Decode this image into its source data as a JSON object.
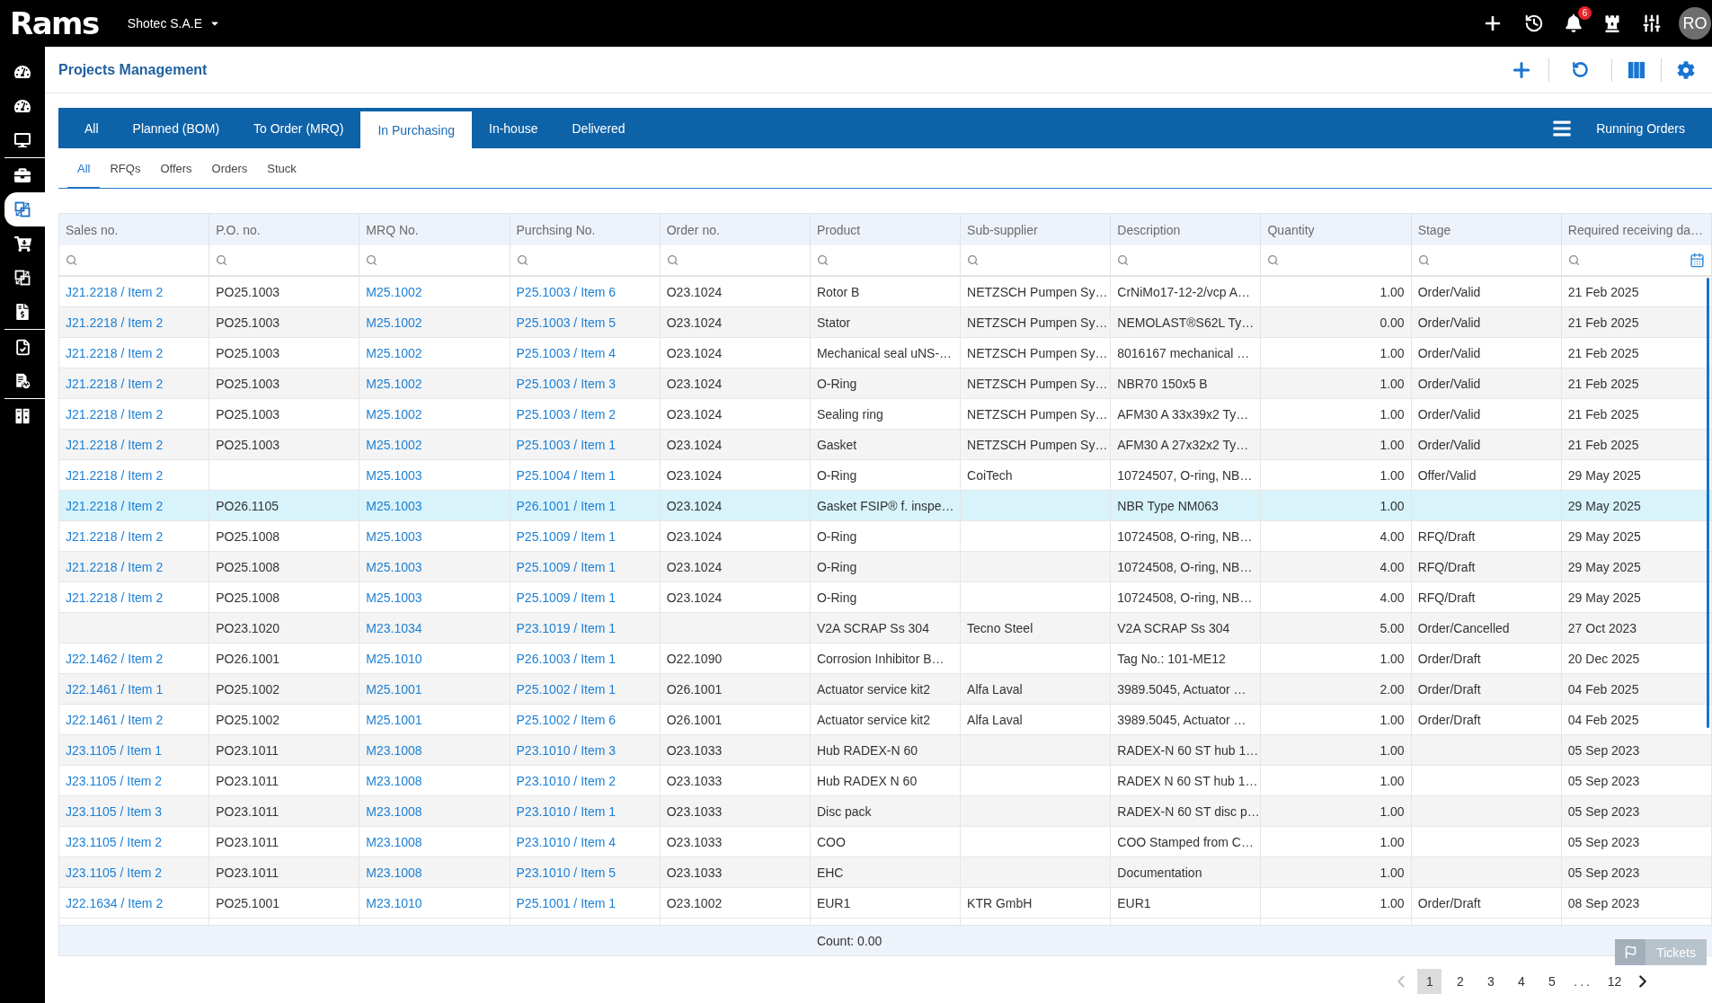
{
  "top_bar": {
    "logo": "Rams",
    "company": "Shotec S.A.E",
    "notifications": "6",
    "avatar": "RO"
  },
  "sidebar": {
    "groups": [
      {
        "items": [
          {
            "selected": false
          },
          {
            "selected": false
          },
          {
            "selected": false
          }
        ]
      },
      {
        "items": [
          {
            "selected": false
          },
          {
            "selected": true
          },
          {
            "selected": false
          },
          {
            "selected": false
          },
          {
            "selected": false
          }
        ]
      },
      {
        "items": [
          {
            "selected": false
          },
          {
            "selected": false
          }
        ]
      },
      {
        "items": [
          {
            "selected": false
          }
        ]
      }
    ]
  },
  "page": {
    "title": "Projects Management"
  },
  "tabs": [
    {
      "label": "All",
      "selected": false
    },
    {
      "label": "Planned (BOM)",
      "selected": false
    },
    {
      "label": "To Order (MRQ)",
      "selected": false
    },
    {
      "label": "In Purchasing",
      "selected": true
    },
    {
      "label": "In-house",
      "selected": false
    },
    {
      "label": "Delivered",
      "selected": false
    }
  ],
  "running_orders": "Running Orders",
  "subtabs": [
    {
      "label": "All",
      "selected": true
    },
    {
      "label": "RFQs",
      "selected": false
    },
    {
      "label": "Offers",
      "selected": false
    },
    {
      "label": "Orders",
      "selected": false
    },
    {
      "label": "Stuck",
      "selected": false
    }
  ],
  "table": {
    "columns": [
      {
        "label": "Sales no.",
        "kind": "link"
      },
      {
        "label": "P.O. no.",
        "kind": "text"
      },
      {
        "label": "MRQ No.",
        "kind": "link"
      },
      {
        "label": "Purchsing No.",
        "kind": "link"
      },
      {
        "label": "Order no.",
        "kind": "text"
      },
      {
        "label": "Product",
        "kind": "text"
      },
      {
        "label": "Sub-supplier",
        "kind": "text"
      },
      {
        "label": "Description",
        "kind": "text"
      },
      {
        "label": "Quantity",
        "kind": "number"
      },
      {
        "label": "Stage",
        "kind": "text"
      },
      {
        "label": "Required receiving da…",
        "kind": "date"
      }
    ],
    "rows": [
      {
        "selected": false,
        "cells": [
          "J21.2218 / Item 2",
          "PO25.1003",
          "M25.1002",
          "P25.1003 / Item 6",
          "O23.1024",
          "Rotor B",
          "NETZSCH Pumpen Sy…",
          "CrNiMo17-12-2/vcp A…",
          "1.00",
          "Order/Valid",
          "21 Feb 2025"
        ]
      },
      {
        "selected": false,
        "cells": [
          "J21.2218 / Item 2",
          "PO25.1003",
          "M25.1002",
          "P25.1003 / Item 5",
          "O23.1024",
          "Stator",
          "NETZSCH Pumpen Sy…",
          "NEMOLAST®S62L Ty…",
          "0.00",
          "Order/Valid",
          "21 Feb 2025"
        ]
      },
      {
        "selected": false,
        "cells": [
          "J21.2218 / Item 2",
          "PO25.1003",
          "M25.1002",
          "P25.1003 / Item 4",
          "O23.1024",
          "Mechanical seal uNS-…",
          "NETZSCH Pumpen Sy…",
          "8016167 mechanical …",
          "1.00",
          "Order/Valid",
          "21 Feb 2025"
        ]
      },
      {
        "selected": false,
        "cells": [
          "J21.2218 / Item 2",
          "PO25.1003",
          "M25.1002",
          "P25.1003 / Item 3",
          "O23.1024",
          "O-Ring",
          "NETZSCH Pumpen Sy…",
          "NBR70 150x5 B",
          "1.00",
          "Order/Valid",
          "21 Feb 2025"
        ]
      },
      {
        "selected": false,
        "cells": [
          "J21.2218 / Item 2",
          "PO25.1003",
          "M25.1002",
          "P25.1003 / Item 2",
          "O23.1024",
          "Sealing ring",
          "NETZSCH Pumpen Sy…",
          "AFM30 A 33x39x2 Ty…",
          "1.00",
          "Order/Valid",
          "21 Feb 2025"
        ]
      },
      {
        "selected": false,
        "cells": [
          "J21.2218 / Item 2",
          "PO25.1003",
          "M25.1002",
          "P25.1003 / Item 1",
          "O23.1024",
          "Gasket",
          "NETZSCH Pumpen Sy…",
          "AFM30 A 27x32x2 Ty…",
          "1.00",
          "Order/Valid",
          "21 Feb 2025"
        ]
      },
      {
        "selected": false,
        "cells": [
          "J21.2218 / Item 2",
          null,
          "M25.1003",
          "P25.1004 / Item 1",
          "O23.1024",
          "O-Ring",
          "CoiTech",
          "10724507, O-ring, NB…",
          "1.00",
          "Offer/Valid",
          "29 May 2025"
        ]
      },
      {
        "selected": true,
        "cells": [
          "J21.2218 / Item 2",
          "PO26.1105",
          "M25.1003",
          "P26.1001 / Item 1",
          "O23.1024",
          "Gasket FSIP® f. inspe…",
          null,
          "NBR Type NM063",
          "1.00",
          null,
          "29 May 2025"
        ]
      },
      {
        "selected": false,
        "cells": [
          "J21.2218 / Item 2",
          "PO25.1008",
          "M25.1003",
          "P25.1009 / Item 1",
          "O23.1024",
          "O-Ring",
          null,
          "10724508, O-ring, NB…",
          "4.00",
          "RFQ/Draft",
          "29 May 2025"
        ]
      },
      {
        "selected": false,
        "cells": [
          "J21.2218 / Item 2",
          "PO25.1008",
          "M25.1003",
          "P25.1009 / Item 1",
          "O23.1024",
          "O-Ring",
          null,
          "10724508, O-ring, NB…",
          "4.00",
          "RFQ/Draft",
          "29 May 2025"
        ]
      },
      {
        "selected": false,
        "cells": [
          "J21.2218 / Item 2",
          "PO25.1008",
          "M25.1003",
          "P25.1009 / Item 1",
          "O23.1024",
          "O-Ring",
          null,
          "10724508, O-ring, NB…",
          "4.00",
          "RFQ/Draft",
          "29 May 2025"
        ]
      },
      {
        "selected": false,
        "cells": [
          null,
          "PO23.1020",
          "M23.1034",
          "P23.1019 / Item 1",
          null,
          "V2A SCRAP Ss 304",
          "Tecno Steel",
          "V2A SCRAP Ss 304",
          "5.00",
          "Order/Cancelled",
          "27 Oct 2023"
        ]
      },
      {
        "selected": false,
        "cells": [
          "J22.1462 / Item 2",
          "PO26.1001",
          "M25.1010",
          "P26.1003 / Item 1",
          "O22.1090",
          "Corrosion Inhibitor B…",
          null,
          "Tag No.: 101-ME12",
          "1.00",
          "Order/Draft",
          "20 Dec 2025"
        ]
      },
      {
        "selected": false,
        "cells": [
          "J22.1461 / Item 1",
          "PO25.1002",
          "M25.1001",
          "P25.1002 / Item 1",
          "O26.1001",
          "Actuator service kit2",
          "Alfa Laval",
          "3989.5045, Actuator …",
          "2.00",
          "Order/Draft",
          "04 Feb 2025"
        ]
      },
      {
        "selected": false,
        "cells": [
          "J22.1461 / Item 2",
          "PO25.1002",
          "M25.1001",
          "P25.1002 / Item 6",
          "O26.1001",
          "Actuator service kit2",
          "Alfa Laval",
          "3989.5045, Actuator …",
          "1.00",
          "Order/Draft",
          "04 Feb 2025"
        ]
      },
      {
        "selected": false,
        "cells": [
          "J23.1105 / Item 1",
          "PO23.1011",
          "M23.1008",
          "P23.1010 / Item 3",
          "O23.1033",
          "Hub RADEX-N 60",
          null,
          "RADEX-N 60 ST hub 1…",
          "1.00",
          null,
          "05 Sep 2023"
        ]
      },
      {
        "selected": false,
        "cells": [
          "J23.1105 / Item 2",
          "PO23.1011",
          "M23.1008",
          "P23.1010 / Item 2",
          "O23.1033",
          "Hub RADEX N 60",
          null,
          "RADEX N 60 ST hub 1…",
          "1.00",
          null,
          "05 Sep 2023"
        ]
      },
      {
        "selected": false,
        "cells": [
          "J23.1105 / Item 3",
          "PO23.1011",
          "M23.1008",
          "P23.1010 / Item 1",
          "O23.1033",
          "Disc pack",
          null,
          "RADEX-N 60 ST disc p…",
          "1.00",
          null,
          "05 Sep 2023"
        ]
      },
      {
        "selected": false,
        "cells": [
          "J23.1105 / Item 2",
          "PO23.1011",
          "M23.1008",
          "P23.1010 / Item 4",
          "O23.1033",
          "COO",
          null,
          "COO Stamped from C…",
          "1.00",
          null,
          "05 Sep 2023"
        ]
      },
      {
        "selected": false,
        "cells": [
          "J23.1105 / Item 2",
          "PO23.1011",
          "M23.1008",
          "P23.1010 / Item 5",
          "O23.1033",
          "EHC",
          null,
          "Documentation",
          "1.00",
          null,
          "05 Sep 2023"
        ]
      },
      {
        "selected": false,
        "cells": [
          "J22.1634 / Item 2",
          "PO25.1001",
          "M23.1010",
          "P25.1001 / Item 1",
          "O23.1002",
          "EUR1",
          "KTR GmbH",
          "EUR1",
          "1.00",
          "Order/Draft",
          "08 Sep 2023"
        ]
      }
    ],
    "footer": "Count: 0.00"
  },
  "pagination": {
    "previous": {
      "disabled": true
    },
    "pages": [
      {
        "kind": "page",
        "label": "1",
        "selected": true
      },
      {
        "kind": "page",
        "label": "2",
        "selected": false
      },
      {
        "kind": "page",
        "label": "3",
        "selected": false
      },
      {
        "kind": "page",
        "label": "4",
        "selected": false
      },
      {
        "kind": "page",
        "label": "5",
        "selected": false
      },
      {
        "kind": "gap",
        "label": "..."
      },
      {
        "kind": "page",
        "label": "12",
        "selected": false
      }
    ],
    "next": {
      "disabled": false
    }
  },
  "tickets": {
    "label": "Tickets"
  }
}
